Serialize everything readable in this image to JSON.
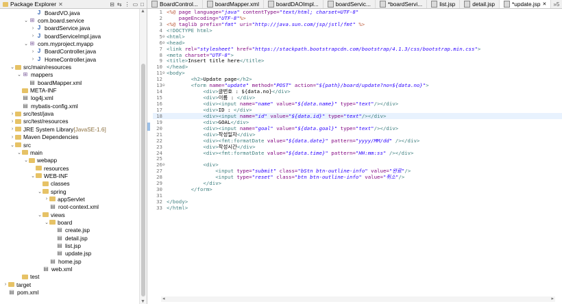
{
  "explorer": {
    "title": "Package Explorer",
    "items": [
      {
        "indent": 4,
        "twisty": "",
        "icon": "java",
        "label": "BoardVO.java",
        "hint": ""
      },
      {
        "indent": 3,
        "twisty": "v",
        "icon": "pkg",
        "label": "com.board.service",
        "hint": ""
      },
      {
        "indent": 4,
        "twisty": ">",
        "icon": "java",
        "label": "boardService.java",
        "hint": ""
      },
      {
        "indent": 4,
        "twisty": ">",
        "icon": "java",
        "label": "boardServiceImpl.java",
        "hint": ""
      },
      {
        "indent": 3,
        "twisty": "v",
        "icon": "pkg",
        "label": "com.myproject.myapp",
        "hint": ""
      },
      {
        "indent": 4,
        "twisty": ">",
        "icon": "java",
        "label": "BoardController.java",
        "hint": ""
      },
      {
        "indent": 4,
        "twisty": ">",
        "icon": "java",
        "label": "HomeController.java",
        "hint": ""
      },
      {
        "indent": 1,
        "twisty": "v",
        "icon": "folder",
        "label": "src/main/resources",
        "hint": ""
      },
      {
        "indent": 2,
        "twisty": "v",
        "icon": "pkg",
        "label": "mappers",
        "hint": ""
      },
      {
        "indent": 3,
        "twisty": "",
        "icon": "file",
        "label": "boardMapper.xml",
        "hint": ""
      },
      {
        "indent": 2,
        "twisty": "",
        "icon": "folder",
        "label": "META-INF",
        "hint": ""
      },
      {
        "indent": 2,
        "twisty": "",
        "icon": "file",
        "label": "log4j.xml",
        "hint": ""
      },
      {
        "indent": 2,
        "twisty": "",
        "icon": "file",
        "label": "mybatis-config.xml",
        "hint": ""
      },
      {
        "indent": 1,
        "twisty": ">",
        "icon": "folder",
        "label": "src/test/java",
        "hint": ""
      },
      {
        "indent": 1,
        "twisty": ">",
        "icon": "folder",
        "label": "src/test/resources",
        "hint": ""
      },
      {
        "indent": 1,
        "twisty": ">",
        "icon": "folder",
        "label": "JRE System Library",
        "hint": "[JavaSE-1.6]"
      },
      {
        "indent": 1,
        "twisty": ">",
        "icon": "folder",
        "label": "Maven Dependencies",
        "hint": ""
      },
      {
        "indent": 1,
        "twisty": "v",
        "icon": "folder",
        "label": "src",
        "hint": ""
      },
      {
        "indent": 2,
        "twisty": "v",
        "icon": "folder",
        "label": "main",
        "hint": ""
      },
      {
        "indent": 3,
        "twisty": "v",
        "icon": "folder",
        "label": "webapp",
        "hint": ""
      },
      {
        "indent": 4,
        "twisty": "",
        "icon": "folder",
        "label": "resources",
        "hint": ""
      },
      {
        "indent": 4,
        "twisty": "v",
        "icon": "folder",
        "label": "WEB-INF",
        "hint": ""
      },
      {
        "indent": 5,
        "twisty": "",
        "icon": "folder",
        "label": "classes",
        "hint": ""
      },
      {
        "indent": 5,
        "twisty": "v",
        "icon": "folder",
        "label": "spring",
        "hint": ""
      },
      {
        "indent": 6,
        "twisty": ">",
        "icon": "folder",
        "label": "appServlet",
        "hint": ""
      },
      {
        "indent": 6,
        "twisty": "",
        "icon": "file",
        "label": "root-context.xml",
        "hint": ""
      },
      {
        "indent": 5,
        "twisty": "v",
        "icon": "folder",
        "label": "views",
        "hint": ""
      },
      {
        "indent": 6,
        "twisty": "v",
        "icon": "folder",
        "label": "board",
        "hint": ""
      },
      {
        "indent": 7,
        "twisty": "",
        "icon": "file",
        "label": "create.jsp",
        "hint": ""
      },
      {
        "indent": 7,
        "twisty": "",
        "icon": "file",
        "label": "detail.jsp",
        "hint": ""
      },
      {
        "indent": 7,
        "twisty": "",
        "icon": "file",
        "label": "list.jsp",
        "hint": ""
      },
      {
        "indent": 7,
        "twisty": "",
        "icon": "file",
        "label": "update.jsp",
        "hint": ""
      },
      {
        "indent": 6,
        "twisty": "",
        "icon": "file",
        "label": "home.jsp",
        "hint": ""
      },
      {
        "indent": 5,
        "twisty": "",
        "icon": "file",
        "label": "web.xml",
        "hint": ""
      },
      {
        "indent": 2,
        "twisty": "",
        "icon": "folder",
        "label": "test",
        "hint": ""
      },
      {
        "indent": 0,
        "twisty": ">",
        "icon": "folder",
        "label": "target",
        "hint": ""
      },
      {
        "indent": 0,
        "twisty": "",
        "icon": "file",
        "label": "pom.xml",
        "hint": ""
      }
    ]
  },
  "tabs": [
    {
      "label": "BoardControl...",
      "active": false
    },
    {
      "label": "boardMapper.xml",
      "active": false
    },
    {
      "label": "boardDAOImpl...",
      "active": false
    },
    {
      "label": "boardServic...",
      "active": false
    },
    {
      "label": "*boardServi...",
      "active": false
    },
    {
      "label": "list.jsp",
      "active": false
    },
    {
      "label": "detail.jsp",
      "active": false
    },
    {
      "label": "*update.jsp",
      "active": true
    }
  ],
  "tab_overflow": "»5",
  "current_line": 18,
  "code_lines": [
    {
      "n": "1",
      "fold": "",
      "parts": [
        [
          "jsp",
          "<%@ "
        ],
        [
          "attr",
          "page language="
        ],
        [
          "str",
          "\"java\""
        ],
        [
          "attr",
          " contentType="
        ],
        [
          "str",
          "\"text/html; charset=UTF-8\""
        ]
      ]
    },
    {
      "n": "2",
      "fold": "",
      "parts": [
        [
          "attr",
          "    pageEncoding="
        ],
        [
          "str",
          "\"UTF-8\""
        ],
        [
          "jsp",
          "%>"
        ]
      ]
    },
    {
      "n": "3",
      "fold": "",
      "parts": [
        [
          "jsp",
          "<%@ "
        ],
        [
          "attr",
          "taglib prefix="
        ],
        [
          "str",
          "\"fmt\""
        ],
        [
          "attr",
          " uri="
        ],
        [
          "str",
          "\"http://java.sun.com/jsp/jstl/fmt\""
        ],
        [
          "jsp",
          " %>"
        ]
      ]
    },
    {
      "n": "4",
      "fold": "",
      "parts": [
        [
          "tag",
          "<!DOCTYPE html>"
        ]
      ]
    },
    {
      "n": "5",
      "fold": "⊖",
      "parts": [
        [
          "tag",
          "<html>"
        ]
      ]
    },
    {
      "n": "6",
      "fold": "⊖",
      "parts": [
        [
          "tag",
          "<head>"
        ]
      ]
    },
    {
      "n": "7",
      "fold": "",
      "parts": [
        [
          "tag",
          "<link "
        ],
        [
          "attr",
          "rel="
        ],
        [
          "str",
          "\"stylesheet\""
        ],
        [
          "attr",
          " href="
        ],
        [
          "str",
          "\"https://stackpath.bootstrapcdn.com/bootstrap/4.1.3/css/bootstrap.min.css\""
        ],
        [
          "tag",
          ">"
        ]
      ]
    },
    {
      "n": "8",
      "fold": "",
      "parts": [
        [
          "tag",
          "<meta "
        ],
        [
          "attr",
          "charset="
        ],
        [
          "str",
          "\"UTF-8\""
        ],
        [
          "tag",
          ">"
        ]
      ]
    },
    {
      "n": "9",
      "fold": "",
      "parts": [
        [
          "tag",
          "<title>"
        ],
        [
          "t",
          "Insert title here"
        ],
        [
          "tag",
          "</title>"
        ]
      ]
    },
    {
      "n": "10",
      "fold": "",
      "parts": [
        [
          "tag",
          "</head>"
        ]
      ]
    },
    {
      "n": "11",
      "fold": "⊖",
      "parts": [
        [
          "tag",
          "<body>"
        ]
      ]
    },
    {
      "n": "12",
      "fold": "",
      "parts": [
        [
          "t",
          "        "
        ],
        [
          "tag",
          "<h2>"
        ],
        [
          "t",
          "Update page"
        ],
        [
          "tag",
          "</h2>"
        ]
      ]
    },
    {
      "n": "13",
      "fold": "⊖",
      "parts": [
        [
          "t",
          "        "
        ],
        [
          "tag",
          "<form "
        ],
        [
          "attr",
          "name="
        ],
        [
          "str",
          "\"update\""
        ],
        [
          "attr",
          " method="
        ],
        [
          "str",
          "\"POST\""
        ],
        [
          "attr",
          " action="
        ],
        [
          "str",
          "\"${path}/board/update?no=${data.no}\""
        ],
        [
          "tag",
          ">"
        ]
      ]
    },
    {
      "n": "14",
      "fold": "",
      "parts": [
        [
          "t",
          "            "
        ],
        [
          "tag",
          "<div>"
        ],
        [
          "t",
          "글번호 : ${data.no}"
        ],
        [
          "tag",
          "</div>"
        ]
      ]
    },
    {
      "n": "15",
      "fold": "",
      "parts": [
        [
          "t",
          "            "
        ],
        [
          "tag",
          "<div>"
        ],
        [
          "t",
          "이름 : "
        ],
        [
          "tag",
          "</div>"
        ]
      ]
    },
    {
      "n": "16",
      "fold": "",
      "parts": [
        [
          "t",
          "            "
        ],
        [
          "tag",
          "<div><input "
        ],
        [
          "attr",
          "name="
        ],
        [
          "str",
          "\"name\""
        ],
        [
          "attr",
          " value="
        ],
        [
          "str",
          "\"${data.name}\""
        ],
        [
          "attr",
          " type="
        ],
        [
          "str",
          "\"text\""
        ],
        [
          "tag",
          "/></div>"
        ]
      ]
    },
    {
      "n": "17",
      "fold": "",
      "parts": [
        [
          "t",
          "            "
        ],
        [
          "tag",
          "<div>"
        ],
        [
          "t",
          "ID : "
        ],
        [
          "tag",
          "</div>"
        ]
      ]
    },
    {
      "n": "18",
      "fold": "",
      "parts": [
        [
          "t",
          "            "
        ],
        [
          "tag",
          "<div><input "
        ],
        [
          "attr",
          "name="
        ],
        [
          "str",
          "\"id\""
        ],
        [
          "attr",
          " value="
        ],
        [
          "str",
          "\"${data.id}\""
        ],
        [
          "attr",
          " type="
        ],
        [
          "str",
          "\"text\""
        ],
        [
          "tag",
          "/></div>"
        ]
      ]
    },
    {
      "n": "19",
      "fold": "",
      "parts": [
        [
          "t",
          "            "
        ],
        [
          "tag",
          "<div>"
        ],
        [
          "t",
          "GOAL"
        ],
        [
          "tag",
          "</div>"
        ]
      ]
    },
    {
      "n": "20",
      "fold": "",
      "parts": [
        [
          "t",
          "            "
        ],
        [
          "tag",
          "<div><input "
        ],
        [
          "attr",
          "name="
        ],
        [
          "str",
          "\"goal\""
        ],
        [
          "attr",
          " value="
        ],
        [
          "str",
          "\"${data.goal}\""
        ],
        [
          "attr",
          " type="
        ],
        [
          "str",
          "\"text\""
        ],
        [
          "tag",
          "/></div>"
        ]
      ]
    },
    {
      "n": "21",
      "fold": "",
      "parts": [
        [
          "t",
          "            "
        ],
        [
          "tag",
          "<div>"
        ],
        [
          "t",
          "작성일자"
        ],
        [
          "tag",
          "</div>"
        ]
      ]
    },
    {
      "n": "22",
      "fold": "",
      "parts": [
        [
          "t",
          "            "
        ],
        [
          "tag",
          "<div><fmt:formatDate "
        ],
        [
          "attr",
          "value="
        ],
        [
          "str",
          "\"${data.date}\""
        ],
        [
          "attr",
          " pattern="
        ],
        [
          "str",
          "\"yyyy/MM/dd\""
        ],
        [
          "tag",
          " /></div>"
        ]
      ]
    },
    {
      "n": "23",
      "fold": "",
      "parts": [
        [
          "t",
          "            "
        ],
        [
          "tag",
          "<div>"
        ],
        [
          "t",
          "작성시간"
        ],
        [
          "tag",
          "</div>"
        ]
      ]
    },
    {
      "n": "24",
      "fold": "",
      "parts": [
        [
          "t",
          "            "
        ],
        [
          "tag",
          "<div><fmt:formatDate "
        ],
        [
          "attr",
          "value="
        ],
        [
          "str",
          "\"${data.time}\""
        ],
        [
          "attr",
          " pattern="
        ],
        [
          "str",
          "\"HH:mm:ss\""
        ],
        [
          "tag",
          " /></div>"
        ]
      ]
    },
    {
      "n": "25",
      "fold": "",
      "parts": []
    },
    {
      "n": "26",
      "fold": "⊖",
      "parts": [
        [
          "t",
          "            "
        ],
        [
          "tag",
          "<div>"
        ]
      ]
    },
    {
      "n": "27",
      "fold": "",
      "parts": [
        [
          "t",
          "                "
        ],
        [
          "tag",
          "<input "
        ],
        [
          "attr",
          "type="
        ],
        [
          "str",
          "\"submit\""
        ],
        [
          "attr",
          " class="
        ],
        [
          "str",
          "\"bStn btn-outline-info\""
        ],
        [
          "attr",
          " value="
        ],
        [
          "str",
          "\"완료\""
        ],
        [
          "tag",
          "/>"
        ]
      ]
    },
    {
      "n": "28",
      "fold": "",
      "parts": [
        [
          "t",
          "                "
        ],
        [
          "tag",
          "<input "
        ],
        [
          "attr",
          "type="
        ],
        [
          "str",
          "\"reset\""
        ],
        [
          "attr",
          " class="
        ],
        [
          "str",
          "\"btn btn-outline-info\""
        ],
        [
          "attr",
          " value="
        ],
        [
          "str",
          "\"취소\""
        ],
        [
          "tag",
          "/>"
        ]
      ]
    },
    {
      "n": "29",
      "fold": "",
      "parts": [
        [
          "t",
          "            "
        ],
        [
          "tag",
          "</div>"
        ]
      ]
    },
    {
      "n": "30",
      "fold": "",
      "parts": [
        [
          "t",
          "        "
        ],
        [
          "tag",
          "</form>"
        ]
      ]
    },
    {
      "n": "31",
      "fold": "",
      "parts": []
    },
    {
      "n": "32",
      "fold": "",
      "parts": [
        [
          "tag",
          "</body>"
        ]
      ]
    },
    {
      "n": "33",
      "fold": "",
      "parts": [
        [
          "tag",
          "</html>"
        ]
      ]
    }
  ]
}
